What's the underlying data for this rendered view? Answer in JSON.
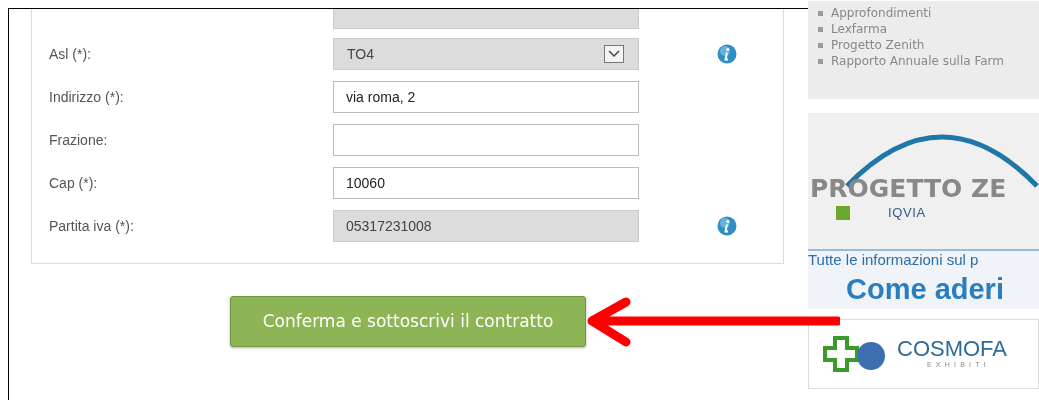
{
  "form": {
    "fields": [
      {
        "kind": "select",
        "label": "Asl (*):",
        "value": "TO4",
        "disabled": true,
        "info": true
      },
      {
        "kind": "text",
        "label": "Indirizzo (*):",
        "value": "via roma, 2",
        "disabled": false,
        "info": false
      },
      {
        "kind": "text",
        "label": "Frazione:",
        "disabled": false,
        "info": false
      },
      {
        "kind": "text",
        "label": "Cap (*):",
        "value": "10060",
        "disabled": false,
        "info": false
      },
      {
        "kind": "text",
        "label": "Partita iva (*):",
        "value": "05317231008",
        "disabled": true,
        "info": true
      }
    ]
  },
  "submit_button": "Conferma e sottoscrivi il contratto",
  "sidebar": {
    "links": [
      "Approfondimenti",
      "Lexfarma",
      "Progetto Zenith",
      "Rapporto Annuale sulla Farm"
    ],
    "zenith_banner": {
      "title": "PROGETTO ZE",
      "partner": "IQVIA",
      "caption": "Tutte le informazioni sul p",
      "cta": "Come aderi"
    },
    "cosmofarma_banner": {
      "title": "COSMOFA",
      "subtitle": "EXHIBITI"
    }
  }
}
